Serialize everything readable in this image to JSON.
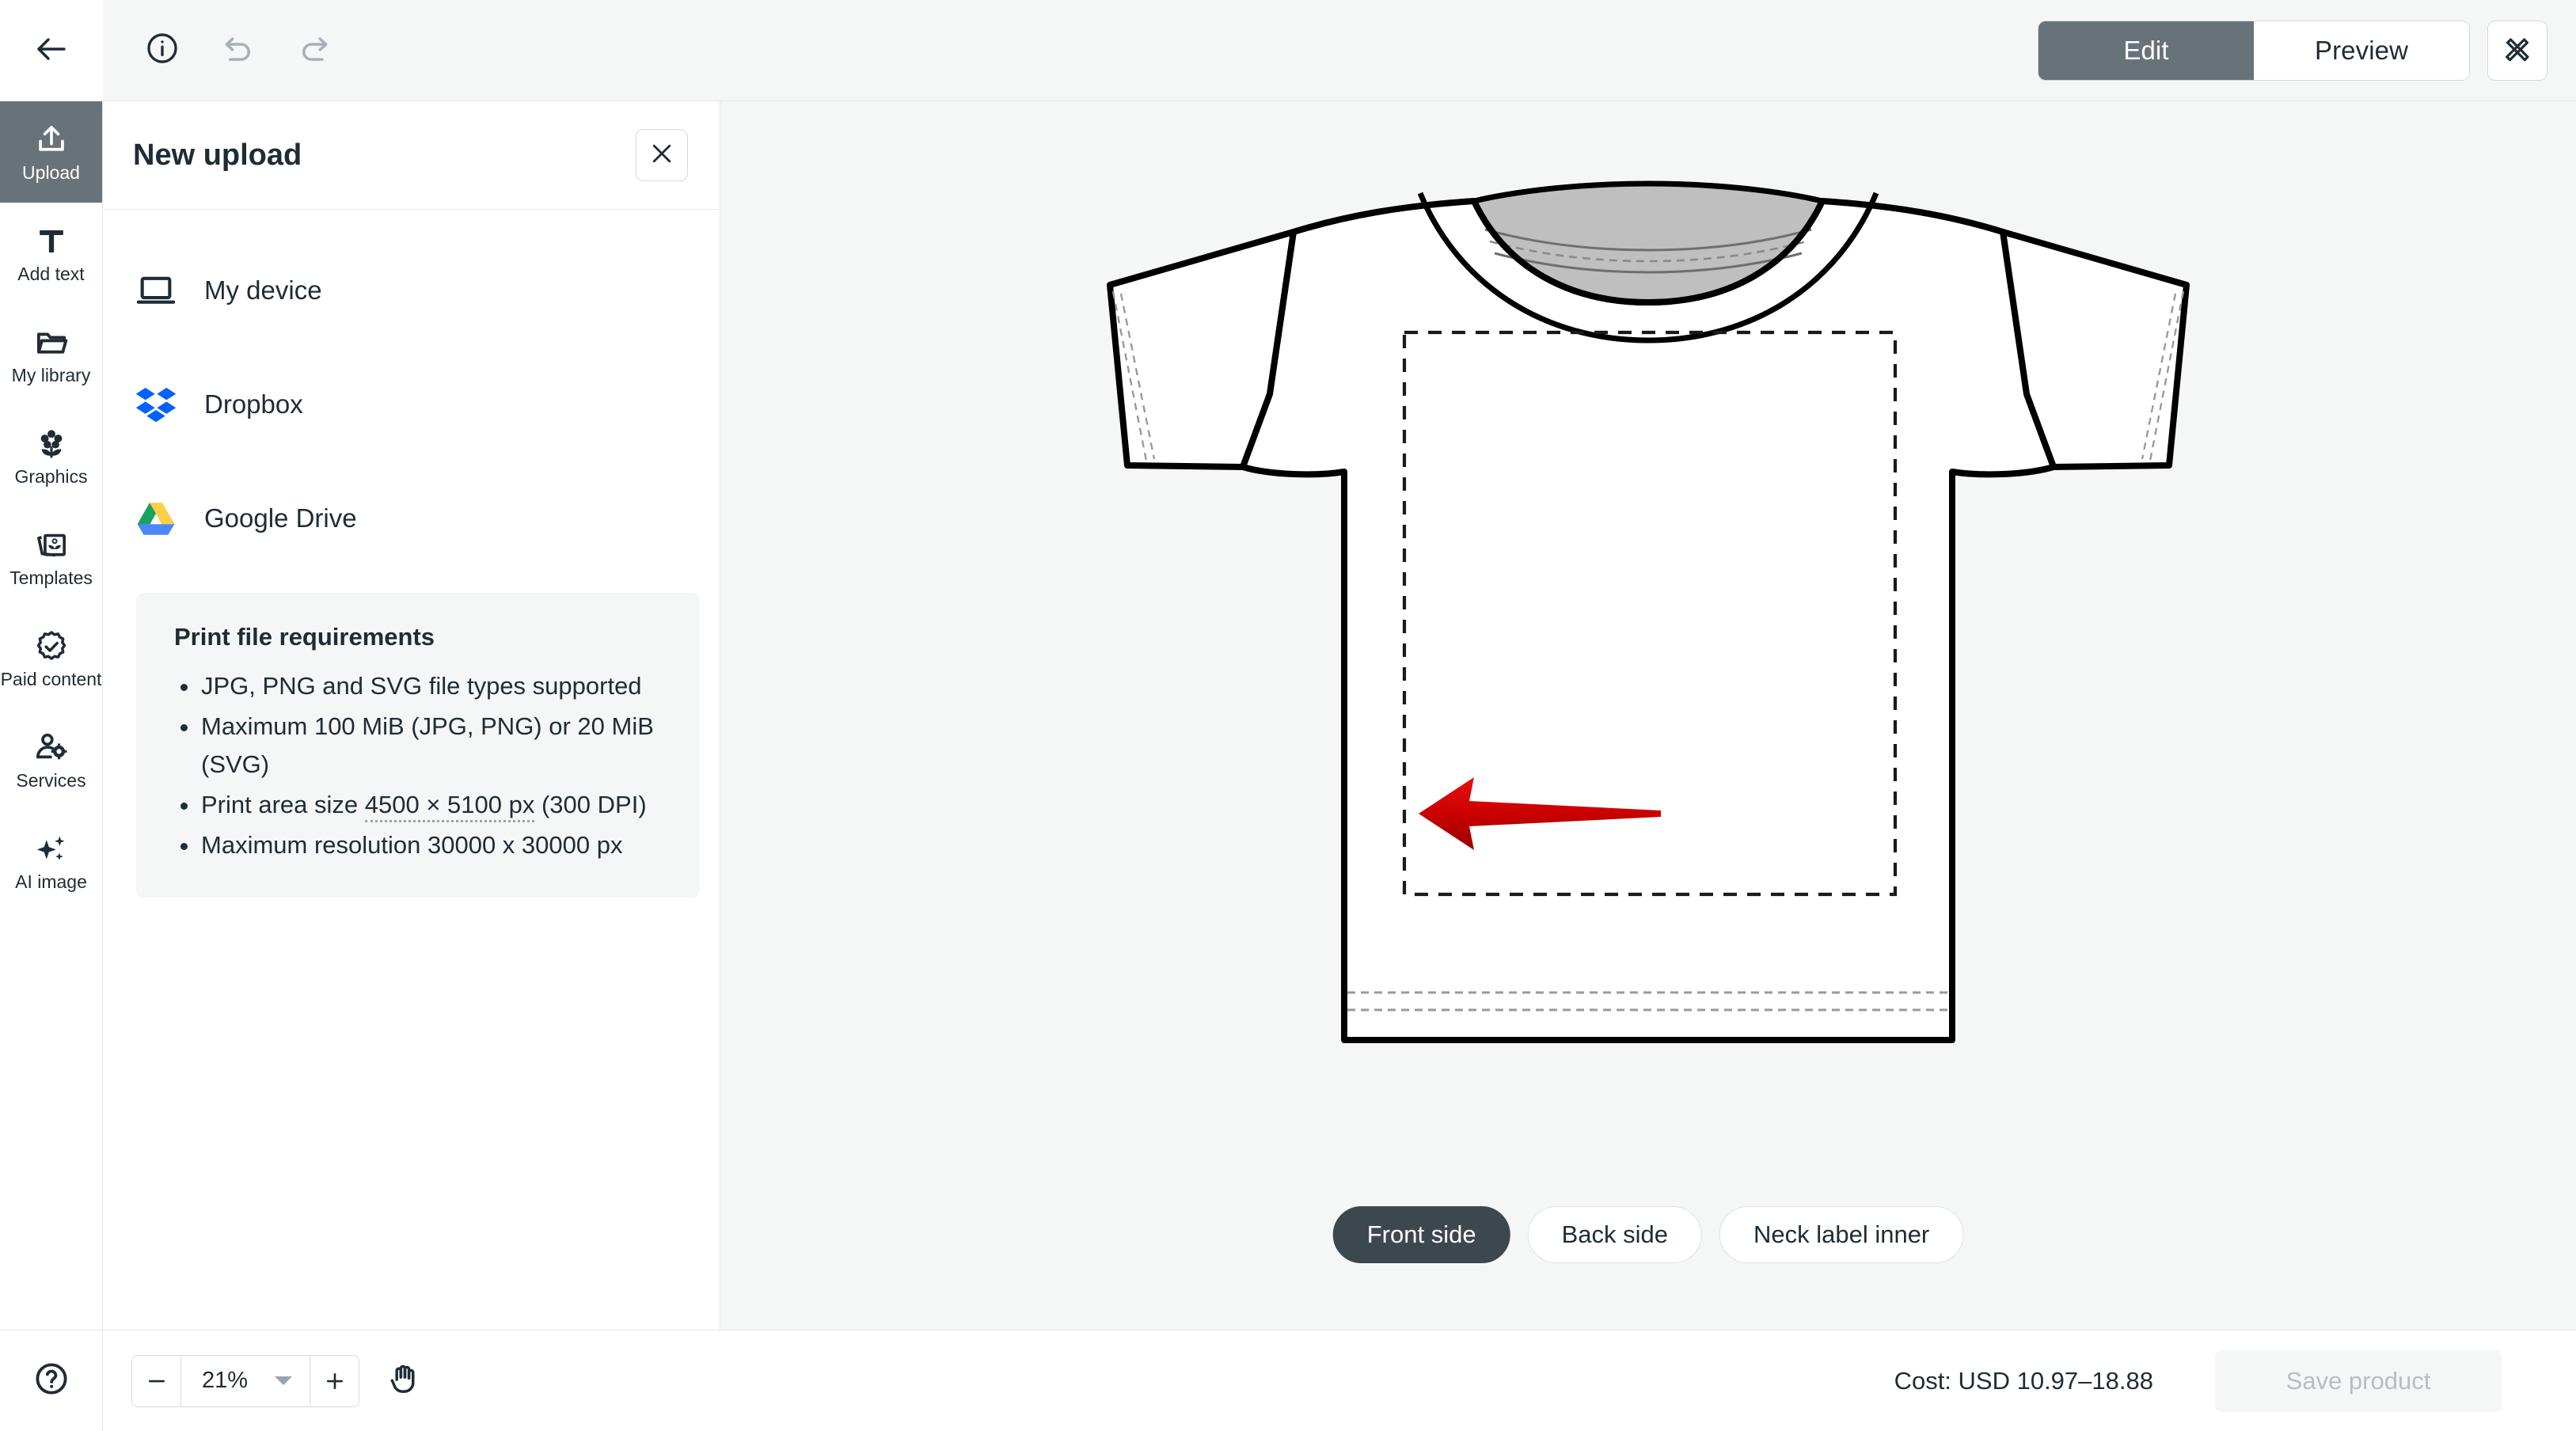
{
  "topbar": {
    "back_icon": "arrow-left-icon",
    "info_icon": "info-circle-icon",
    "undo_icon": "undo-icon",
    "redo_icon": "redo-icon",
    "mode_tabs": [
      {
        "label": "Edit",
        "active": true
      },
      {
        "label": "Preview",
        "active": false
      }
    ],
    "design_tools_icon": "ruler-pencil-icon"
  },
  "rail": {
    "items": [
      {
        "label": "Upload",
        "icon": "upload-icon",
        "active": true
      },
      {
        "label": "Add text",
        "icon": "text-t-icon",
        "active": false
      },
      {
        "label": "My library",
        "icon": "folder-icon",
        "active": false
      },
      {
        "label": "Graphics",
        "icon": "flower-icon",
        "active": false
      },
      {
        "label": "Templates",
        "icon": "templates-stack-icon",
        "active": false
      },
      {
        "label": "Paid content",
        "icon": "badge-check-icon",
        "active": false
      },
      {
        "label": "Services",
        "icon": "person-gear-icon",
        "active": false
      },
      {
        "label": "AI image",
        "icon": "sparkles-icon",
        "active": false
      }
    ]
  },
  "panel": {
    "title": "New upload",
    "close_icon": "close-icon",
    "options": [
      {
        "label": "My device",
        "icon": "laptop-icon"
      },
      {
        "label": "Dropbox",
        "icon": "dropbox-icon"
      },
      {
        "label": "Google Drive",
        "icon": "google-drive-icon"
      }
    ],
    "requirements": {
      "title": "Print file requirements",
      "items": [
        {
          "text": "JPG, PNG and SVG file types supported"
        },
        {
          "text": "Maximum 100 MiB (JPG, PNG) or 20 MiB (SVG)"
        },
        {
          "prefix": "Print area size ",
          "highlight": "4500 × 5100 px",
          "suffix": " (300 DPI)"
        },
        {
          "text": "Maximum resolution 30000 x 30000 px"
        }
      ]
    }
  },
  "canvas": {
    "product": "t-shirt-front-mockup",
    "annotation_icon": "red-arrow-left-annotation",
    "side_tabs": [
      {
        "label": "Front side",
        "active": true
      },
      {
        "label": "Back side",
        "active": false
      },
      {
        "label": "Neck label inner",
        "active": false
      }
    ]
  },
  "bottombar": {
    "help_icon": "help-circle-icon",
    "zoom": {
      "minus_icon": "minus-icon",
      "value": "21%",
      "caret_icon": "chevron-down-icon",
      "plus_icon": "plus-icon"
    },
    "pan_icon": "hand-pan-icon",
    "cost_label": "Cost: USD 10.97–18.88",
    "save_label": "Save product"
  },
  "colors": {
    "accent_dark": "#687279",
    "text_dark": "#1f2c35",
    "panel_bg": "#f5f6f6",
    "pill_active": "#3d474e",
    "annotation_red": "#cc0000",
    "dropbox_blue": "#0061fe"
  }
}
